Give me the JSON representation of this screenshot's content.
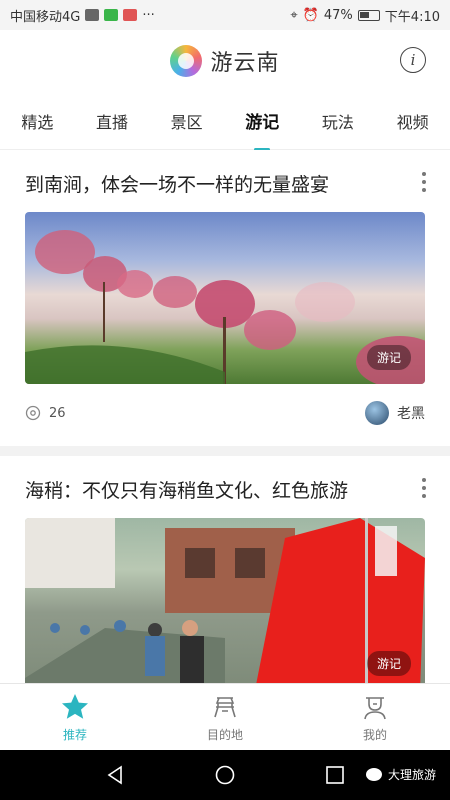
{
  "status_bar": {
    "carrier": "中国移动4G",
    "battery": "47%",
    "time": "下午4:10"
  },
  "header": {
    "app_name": "游云南",
    "info_label": "i"
  },
  "tabs": [
    {
      "label": "精选"
    },
    {
      "label": "直播"
    },
    {
      "label": "景区"
    },
    {
      "label": "游记",
      "active": true
    },
    {
      "label": "玩法"
    },
    {
      "label": "视频"
    }
  ],
  "feed": {
    "cards": [
      {
        "title": "到南涧，体会一场不一样的无量盛宴",
        "tag": "游记",
        "views": "26",
        "author": "老黑"
      },
      {
        "title": "海稍：不仅只有海稍鱼文化、红色旅游",
        "tag": "游记"
      }
    ]
  },
  "bottom_nav": [
    {
      "label": "推荐",
      "icon": "star-icon",
      "active": true
    },
    {
      "label": "目的地",
      "icon": "destination-icon"
    },
    {
      "label": "我的",
      "icon": "profile-icon"
    }
  ],
  "watermark": {
    "text": "大理旅游"
  },
  "colors": {
    "accent": "#2bb5c0"
  }
}
